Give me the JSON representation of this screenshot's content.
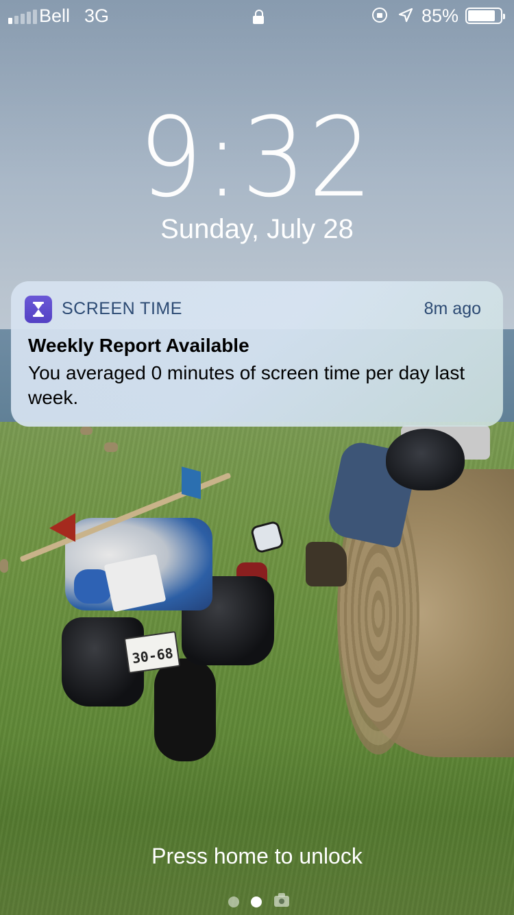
{
  "status_bar": {
    "carrier": "Bell",
    "network": "3G",
    "signal_bars_filled": 1,
    "signal_bars_total": 5,
    "icons": [
      "lock-icon",
      "rotation-lock-icon",
      "location-arrow-icon"
    ],
    "battery_percent": "85%",
    "battery_level": 0.85
  },
  "lock_screen": {
    "time": "9:32",
    "date": "Sunday, July 28"
  },
  "notification": {
    "app_icon": "hourglass-icon",
    "app_name": "SCREEN TIME",
    "time_ago": "8m ago",
    "title": "Weekly Report Available",
    "body": "You averaged 0 minutes of screen time per day last week.",
    "accent_color": "#5a46c9"
  },
  "wallpaper": {
    "license_plate": "30-68"
  },
  "footer": {
    "unlock_hint": "Press home to unlock",
    "pages": 3,
    "current_page": 2,
    "page_icons": [
      "dot",
      "dot",
      "camera-icon"
    ]
  }
}
